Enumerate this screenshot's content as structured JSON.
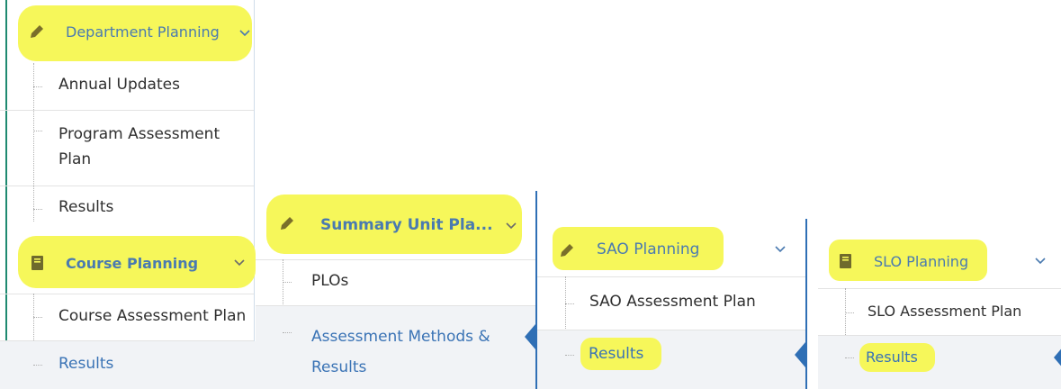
{
  "panel1": {
    "header_label": "Department Planning",
    "items": [
      "Annual Updates",
      "Program Assessment Plan",
      "Results"
    ],
    "section2_label": "Course Planning",
    "section2_items": [
      "Course Assessment Plan",
      "Results"
    ]
  },
  "panel2": {
    "header_label": "Summary Unit Pla...",
    "items": [
      "PLOs",
      "Assessment Methods & Results"
    ]
  },
  "panel3": {
    "header_label": "SAO Planning",
    "items": [
      "SAO Assessment Plan",
      "Results"
    ]
  },
  "panel4": {
    "header_label": "SLO Planning",
    "items": [
      "SLO Assessment Plan",
      "Results"
    ]
  },
  "colors": {
    "highlight": "#f6f75a",
    "link_blue": "#3a73b5",
    "accent_bar": "#2f6fb5",
    "teal_border": "#1f8a70"
  },
  "icons": [
    "pencil-icon",
    "book-icon",
    "chevron-down-icon"
  ]
}
